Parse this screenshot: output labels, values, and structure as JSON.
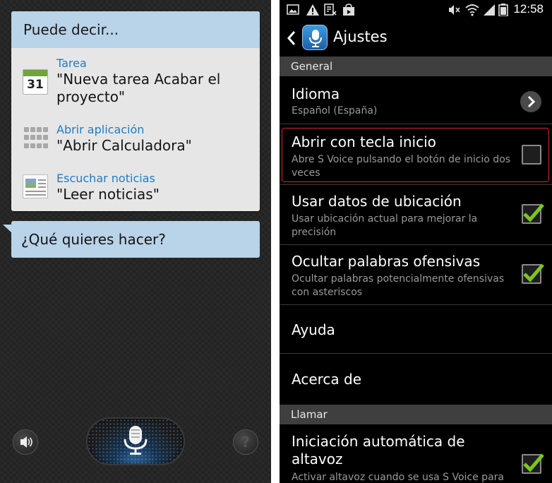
{
  "left_panel": {
    "card_header": "Puede decir...",
    "suggestions": [
      {
        "category": "Tarea",
        "example": "\"Nueva tarea Acabar el proyecto\"",
        "icon": "calendar-icon",
        "calendar_day": "31"
      },
      {
        "category": "Abrir aplicación",
        "example": "\"Abrir Calculadora\"",
        "icon": "apps-grid-icon"
      },
      {
        "category": "Escuchar noticias",
        "example": "\"Leer noticias\"",
        "icon": "news-icon"
      }
    ],
    "prompt": "¿Qué quieres hacer?",
    "help_symbol": "?",
    "colors": {
      "bubble": "#b9d3e8",
      "link": "#1f7cc3"
    }
  },
  "right_panel": {
    "status_bar": {
      "time": "12:58"
    },
    "title": "Ajustes",
    "sections": [
      {
        "header": "General"
      },
      {
        "header": "Llamar"
      }
    ],
    "settings": [
      {
        "title": "Idioma",
        "subtitle": "Español (España)",
        "control": "chevron"
      },
      {
        "title": "Abrir con tecla inicio",
        "subtitle": "Abre S Voice pulsando el botón de inicio dos veces",
        "control": "checkbox",
        "checked": false,
        "highlighted": true
      },
      {
        "title": "Usar datos de ubicación",
        "subtitle": "Usar ubicación actual para mejorar la precisión",
        "control": "checkbox",
        "checked": true
      },
      {
        "title": "Ocultar palabras ofensivas",
        "subtitle": "Ocultar palabras potencialmente ofensivas con asteriscos",
        "control": "checkbox",
        "checked": true
      },
      {
        "title": "Ayuda"
      },
      {
        "title": "Acerca de"
      },
      {
        "title": "Iniciación automática de altavoz",
        "subtitle": "Activar altavoz cuando se usa S Voice para",
        "control": "checkbox",
        "checked": true
      }
    ],
    "colors": {
      "check": "#7cc61f",
      "highlight": "#d7262c"
    }
  }
}
